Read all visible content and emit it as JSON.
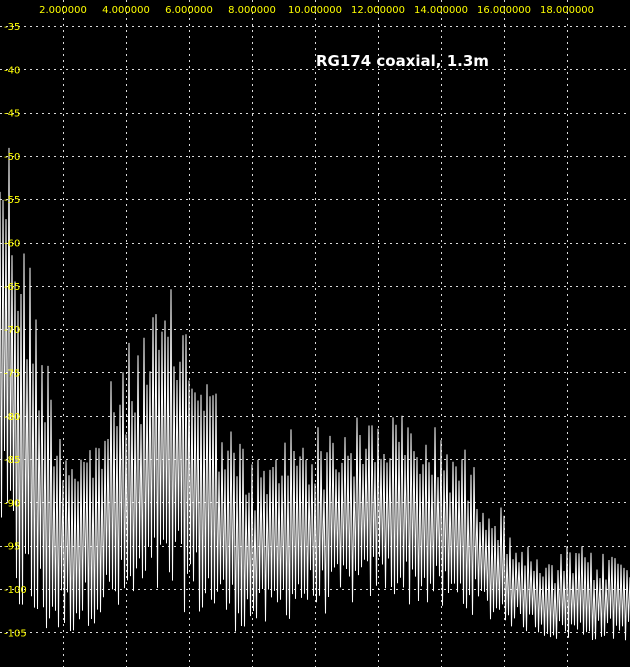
{
  "chart_data": {
    "type": "line",
    "title": "RG174 coaxial, 1.3m",
    "xlabel": "",
    "ylabel": "",
    "x_ticks": [
      "2.000000",
      "4.000000",
      "6.000000",
      "8.000000",
      "10.000000",
      "12.000000",
      "14.000000",
      "16.000000",
      "18.000000"
    ],
    "x_tick_values": [
      2,
      4,
      6,
      8,
      10,
      12,
      14,
      16,
      18
    ],
    "y_ticks": [
      "-35",
      "-40",
      "-45",
      "-50",
      "-55",
      "-60",
      "-65",
      "-70",
      "-75",
      "-80",
      "-85",
      "-90",
      "-95",
      "-100",
      "-105"
    ],
    "y_tick_values": [
      -35,
      -40,
      -45,
      -50,
      -55,
      -60,
      -65,
      -70,
      -75,
      -80,
      -85,
      -90,
      -95,
      -100,
      -105
    ],
    "xlim": [
      0,
      20
    ],
    "ylim": [
      -109,
      -32
    ],
    "grid": true,
    "series": [
      {
        "color": "#ffffff",
        "envelope": {
          "x": [
            0,
            0.3,
            0.6,
            1,
            1.5,
            2,
            2.5,
            3,
            3.5,
            4,
            4.5,
            5,
            5.5,
            6,
            6.5,
            7,
            7.5,
            8,
            8.5,
            9,
            9.5,
            10,
            10.5,
            11,
            11.5,
            12,
            12.5,
            13,
            13.5,
            14,
            14.5,
            15,
            15.5,
            16,
            16.5,
            17,
            17.5,
            18,
            18.5,
            19,
            19.5,
            20
          ],
          "peak": [
            -42,
            -46,
            -55,
            -62,
            -72,
            -80,
            -82,
            -82,
            -76,
            -72,
            -69,
            -67,
            -65,
            -68,
            -72,
            -78,
            -82,
            -84,
            -85,
            -81,
            -80,
            -81,
            -81,
            -80,
            -80,
            -79,
            -79,
            -80,
            -81,
            -81,
            -82,
            -85,
            -88,
            -91,
            -94,
            -96,
            -97,
            -95,
            -95,
            -96,
            -95,
            -96
          ],
          "trough": [
            -95,
            -100,
            -104,
            -106,
            -106,
            -106,
            -105,
            -104,
            -104,
            -104,
            -103,
            -102,
            -102,
            -103,
            -104,
            -104,
            -105,
            -105,
            -105,
            -104,
            -103,
            -103,
            -103,
            -102,
            -102,
            -101,
            -101,
            -102,
            -102,
            -103,
            -103,
            -103,
            -104,
            -104,
            -105,
            -105,
            -106,
            -106,
            -106,
            -106,
            -106,
            -106
          ]
        }
      }
    ]
  }
}
